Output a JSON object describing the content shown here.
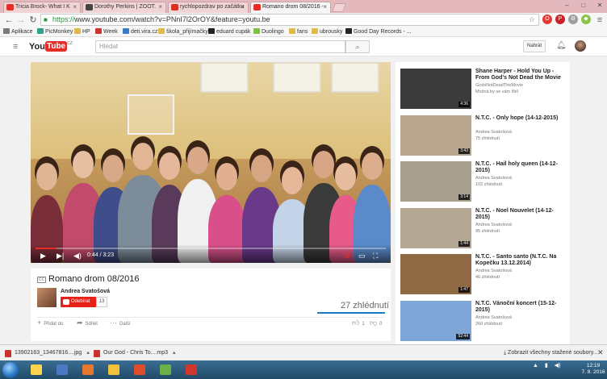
{
  "browser": {
    "tabs": [
      {
        "label": "Tricia Brock- What I K",
        "icon_color": "#e52d27"
      },
      {
        "label": "Dorothy Perkins | ZOOT.",
        "icon_color": "#444444"
      },
      {
        "label": "rychlopozdrav po začátku",
        "icon_color": "#d93025"
      },
      {
        "label": "Romano drom 08/2016 -",
        "icon_color": "#e52d27"
      }
    ],
    "window_controls": [
      "–",
      "□",
      "✕"
    ],
    "url_scheme": "https://",
    "url_rest": "www.youtube.com/watch?v=PNnI7l2OrOY&feature=youtu.be",
    "star": "☆"
  },
  "bookmarks": [
    {
      "label": "Aplikace",
      "color": "#7a7a7a"
    },
    {
      "label": "PicMonkey",
      "color": "#2aa38c"
    },
    {
      "label": "HP",
      "color": "#e0b94a"
    },
    {
      "label": "Week",
      "color": "#c9352c"
    },
    {
      "label": "deti.vira.cz",
      "color": "#3b7bc5"
    },
    {
      "label": "škola_přijímačky",
      "color": "#e0b94a"
    },
    {
      "label": "eduard cupák",
      "color": "#222222"
    },
    {
      "label": "Duolingo",
      "color": "#7cc142"
    },
    {
      "label": "fans",
      "color": "#e0b94a"
    },
    {
      "label": "ubrousky",
      "color": "#e0b94a"
    },
    {
      "label": "Good Day Records - ...",
      "color": "#222222"
    }
  ],
  "youtube": {
    "logo_you": "You",
    "logo_tube": "Tube",
    "logo_region": "CZ",
    "search_placeholder": "Hledat",
    "upload_label": "Nahrát"
  },
  "player": {
    "time": "0:44 / 3:23",
    "progress_fraction": 0.06
  },
  "video": {
    "title": "Romano drom 08/2016",
    "channel": "Andrea Svatošová",
    "subscribe_label": "Odebírat",
    "subscriber_count": "13",
    "views": "27 zhlédnutí",
    "add_to": "Přidat do",
    "share": "Sdílet",
    "more": "Další",
    "likes": "1",
    "dislikes": "0"
  },
  "related": [
    {
      "title": "Shane Harper - Hold You Up - From God's Not Dead the Movie",
      "channel": "GodsNotDeadTheMovie",
      "meta": "Možná by se vám líbil",
      "duration": "4:36",
      "thumb": "#3b3b3b"
    },
    {
      "title": "N.T.C. - Only hope (14-12-2015)",
      "channel": "Andrea Svatošová",
      "meta": "75 zhlédnutí",
      "duration": "3:43",
      "thumb": "#b9a88f"
    },
    {
      "title": "N.T.C. - Hail holy queen (14-12-2015)",
      "channel": "Andrea Svatošová",
      "meta": "102 zhlédnutí",
      "duration": "3:14",
      "thumb": "#a7a08f"
    },
    {
      "title": "N.T.C. - Noel Nouvelet (14-12-2015)",
      "channel": "Andrea Svatošová",
      "meta": "95 zhlédnutí",
      "duration": "1:44",
      "thumb": "#b4a794"
    },
    {
      "title": "N.T.C. - Santo santo (N.T.C. Na Kopečku 13.12.2014)",
      "channel": "Andrea Svatošová",
      "meta": "46 zhlédnutí",
      "duration": "1:47",
      "thumb": "#8f6a45"
    },
    {
      "title": "N.T.C. Vánoční koncert (15-12-2015)",
      "channel": "Andrea Svatošová",
      "meta": "260 zhlédnutí",
      "duration": "52:44",
      "thumb": "#7ea6d6"
    }
  ],
  "downloads": [
    {
      "label": "13902163_13467816....jpg",
      "color": "#c8342c"
    },
    {
      "label": "Our God - Chris To....mp3",
      "color": "#c8342c"
    }
  ],
  "shelf_all": "Zobrazit všechny stažené soubory...",
  "taskbar": {
    "apps": [
      "#ffd34d",
      "#4a78c2",
      "#e5772e",
      "#f2c23a",
      "#e04b2c",
      "#6bb14a",
      "#d0362b"
    ],
    "time": "12:19",
    "date": "7. 8. 2016"
  }
}
